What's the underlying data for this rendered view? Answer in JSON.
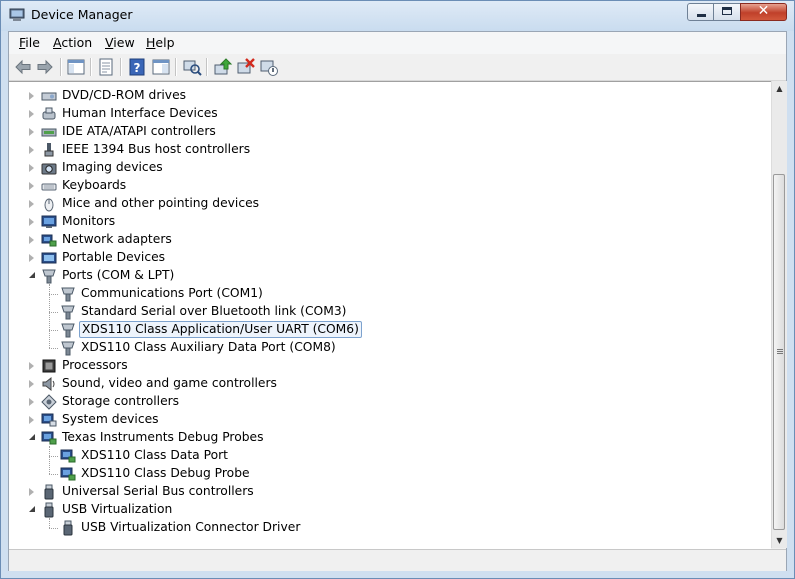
{
  "window": {
    "title": "Device Manager"
  },
  "menu": {
    "file": "File",
    "action": "Action",
    "view": "View",
    "help": "Help"
  },
  "tree": {
    "categories": [
      {
        "label": "DVD/CD-ROM drives",
        "icon": "dvd-drive-icon"
      },
      {
        "label": "Human Interface Devices",
        "icon": "hid-icon"
      },
      {
        "label": "IDE ATA/ATAPI controllers",
        "icon": "ide-controller-icon"
      },
      {
        "label": "IEEE 1394 Bus host controllers",
        "icon": "ieee1394-icon"
      },
      {
        "label": "Imaging devices",
        "icon": "camera-icon"
      },
      {
        "label": "Keyboards",
        "icon": "keyboard-icon"
      },
      {
        "label": "Mice and other pointing devices",
        "icon": "mouse-icon"
      },
      {
        "label": "Monitors",
        "icon": "monitor-icon"
      },
      {
        "label": "Network adapters",
        "icon": "network-adapter-icon"
      },
      {
        "label": "Portable Devices",
        "icon": "portable-device-icon"
      },
      {
        "label": "Ports (COM & LPT)",
        "icon": "port-icon"
      },
      {
        "label": "Communications Port (COM1)",
        "icon": "port-icon"
      },
      {
        "label": "Standard Serial over Bluetooth link (COM3)",
        "icon": "port-icon"
      },
      {
        "label": "XDS110 Class Application/User UART (COM6)",
        "icon": "port-icon"
      },
      {
        "label": "XDS110 Class Auxiliary Data Port (COM8)",
        "icon": "port-icon"
      },
      {
        "label": "Processors",
        "icon": "processor-icon"
      },
      {
        "label": "Sound, video and game controllers",
        "icon": "speaker-icon"
      },
      {
        "label": "Storage controllers",
        "icon": "storage-controller-icon"
      },
      {
        "label": "System devices",
        "icon": "system-device-icon"
      },
      {
        "label": "Texas Instruments Debug Probes",
        "icon": "debug-probe-icon"
      },
      {
        "label": "XDS110 Class Data Port",
        "icon": "debug-probe-icon"
      },
      {
        "label": "XDS110 Class Debug Probe",
        "icon": "debug-probe-icon"
      },
      {
        "label": "Universal Serial Bus controllers",
        "icon": "usb-icon"
      },
      {
        "label": "USB Virtualization",
        "icon": "usb-icon"
      },
      {
        "label": "USB Virtualization Connector Driver",
        "icon": "usb-icon"
      }
    ]
  },
  "status": {
    "text": ""
  },
  "colors": {
    "selection_border": "#7da2ce",
    "selection_fill": "#eef4fc",
    "title_gradient_top": "#dfeaf6",
    "close_red": "#c0402a"
  }
}
